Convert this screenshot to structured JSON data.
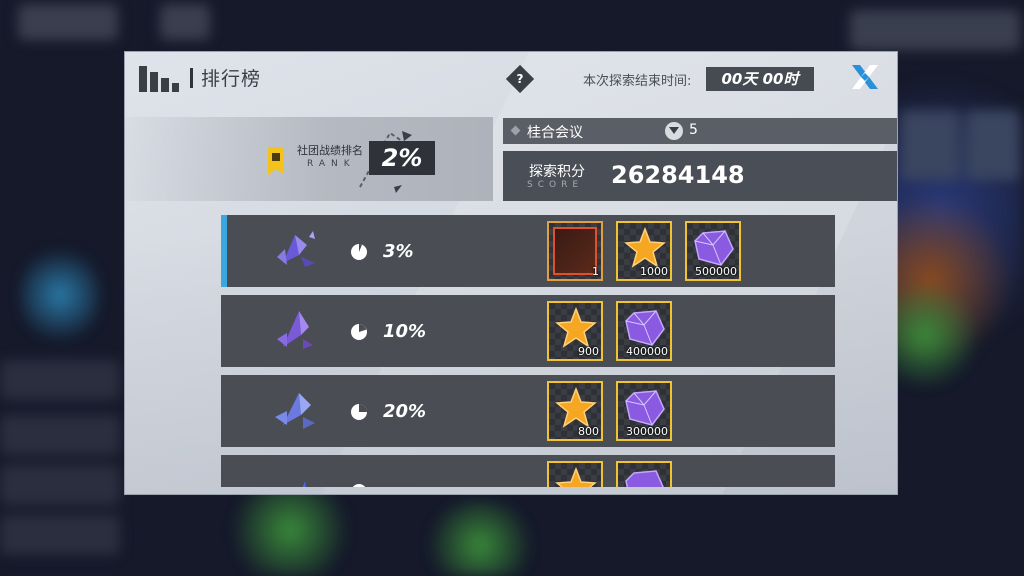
{
  "header": {
    "title": "排行榜",
    "end_time_label": "本次探索结束时间:",
    "end_time_value": "00天 00时"
  },
  "rank": {
    "label": "社团战绩排名",
    "sub_label": "RANK",
    "value": "2%"
  },
  "guild": {
    "name": "桂合会议",
    "count": "5"
  },
  "score": {
    "label": "探索积分",
    "sub_label": "SCORE",
    "value": "26284148"
  },
  "tiers": [
    {
      "percent": "3%",
      "active": true,
      "rewards": [
        {
          "type": "avatar-frame",
          "quantity": "1"
        },
        {
          "type": "star-coin",
          "quantity": "1000"
        },
        {
          "type": "purple-crystal",
          "quantity": "500000"
        }
      ]
    },
    {
      "percent": "10%",
      "active": false,
      "rewards": [
        {
          "type": "star-coin",
          "quantity": "900"
        },
        {
          "type": "purple-crystal",
          "quantity": "400000"
        }
      ]
    },
    {
      "percent": "20%",
      "active": false,
      "rewards": [
        {
          "type": "star-coin",
          "quantity": "800"
        },
        {
          "type": "purple-crystal",
          "quantity": "300000"
        }
      ]
    },
    {
      "percent": "",
      "active": false,
      "rewards": [
        {
          "type": "star-coin",
          "quantity": ""
        },
        {
          "type": "purple-crystal",
          "quantity": ""
        }
      ]
    }
  ],
  "colors": {
    "accent_blue": "#3aa8df",
    "item_border_gold": "#f0c330",
    "row_bg": "#4a4d53",
    "panel_bg": "#dfe3ea"
  }
}
